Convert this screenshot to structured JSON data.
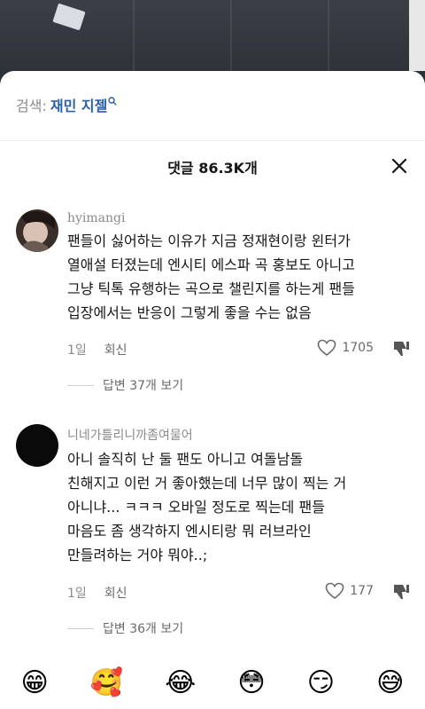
{
  "search": {
    "label": "검색:",
    "query": "재민 지젤"
  },
  "header": {
    "title": "댓글 86.3K개"
  },
  "comments": [
    {
      "username": "hyimangi",
      "text_lines": [
        "팬들이 싫어하는 이유가 지금 정재현이랑 윈터가",
        "열애설 터졌는데 엔시티 에스파 곡 홍보도 아니고",
        "그냥 틱톡 유행하는 곡으로 챌린지를 하는게 팬들",
        "입장에서는 반응이 그렇게 좋을 수는 없음"
      ],
      "time": "1일",
      "reply_label": "회신",
      "likes": "1705",
      "replies_label": "답변 37개 보기"
    },
    {
      "username": "니네가틀리니까좀여물어",
      "text_lines": [
        "아니 솔직히 난 둘 팬도 아니고 여돌남돌",
        "친해지고 이런 거 좋아했는데 너무 많이 찍는 거",
        "아니냐... ㅋㅋㅋ 오바일 정도로 찍는데 팬들",
        "마음도 좀 생각하지 엔시티랑 뭐 러브라인",
        "만들려하는 거야 뭐야..;"
      ],
      "time": "1일",
      "reply_label": "회신",
      "likes": "177",
      "replies_label": "답변 36개 보기"
    }
  ],
  "emojis": [
    "😁",
    "🥰",
    "😂",
    "😳",
    "😏",
    "😅"
  ]
}
